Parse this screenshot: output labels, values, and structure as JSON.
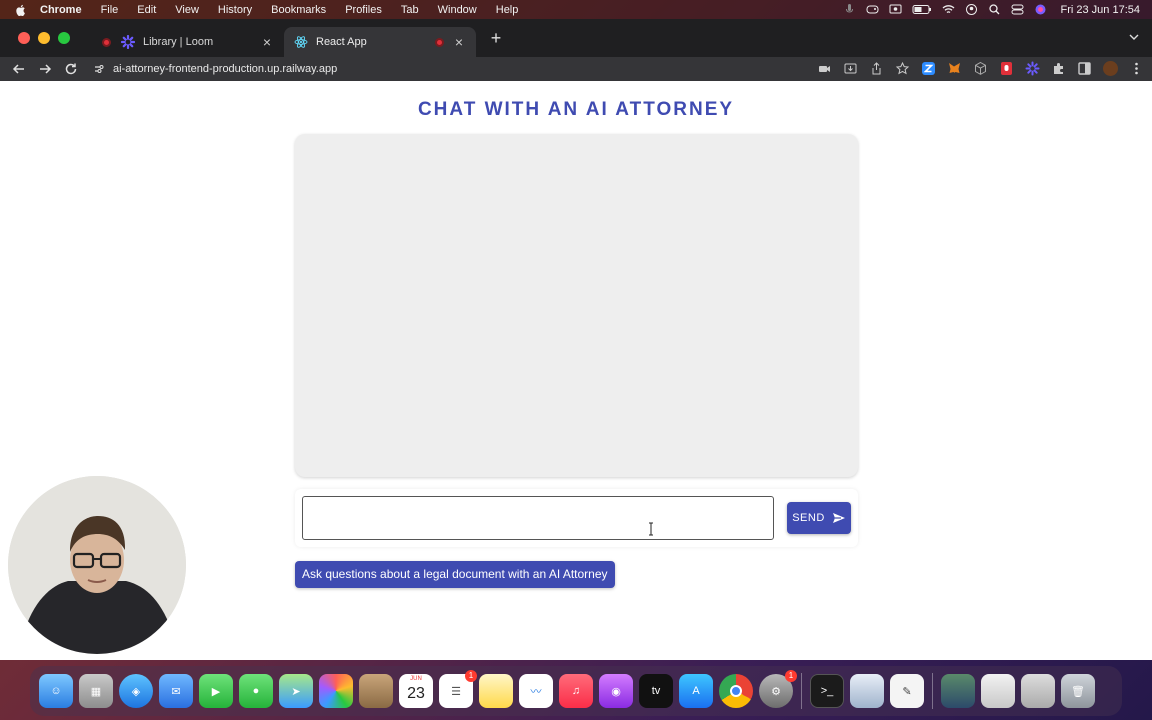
{
  "menubar": {
    "app_name": "Chrome",
    "items": [
      "File",
      "Edit",
      "View",
      "History",
      "Bookmarks",
      "Profiles",
      "Tab",
      "Window",
      "Help"
    ],
    "clock": "Fri 23 Jun  17:54"
  },
  "browser": {
    "tabs": [
      {
        "title": "Library | Loom",
        "icon": "loom-icon",
        "active": false
      },
      {
        "title": "React App",
        "icon": "react-icon",
        "active": true
      }
    ],
    "url": "ai-attorney-frontend-production.up.railway.app"
  },
  "page": {
    "title": "CHAT WITH AN AI ATTORNEY",
    "message_input": {
      "value": "",
      "placeholder": ""
    },
    "send_label": "SEND",
    "caption": "Ask questions about a legal document with an AI Attorney",
    "accent_color": "#3f4bb1"
  },
  "dock": {
    "calendar": {
      "month": "JUN",
      "day": "23"
    },
    "reminders_badge": "1",
    "settings_badge": "1",
    "appletv_label": "tv"
  }
}
